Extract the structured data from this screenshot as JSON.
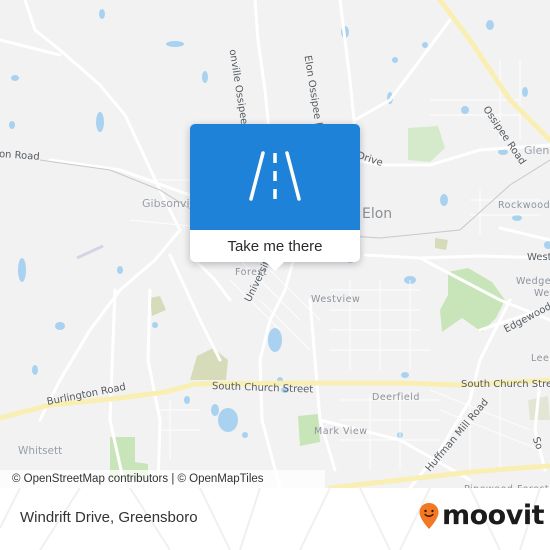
{
  "map": {
    "road_labels": {
      "clapp_mill": "Ossipee Road",
      "elon_ossipee": "Elon Ossipee Road",
      "ossipee": "Ossipee Road",
      "burlington_left": "on Road",
      "drive": "Drive",
      "university": "University Drive",
      "burlington": "Burlington Road",
      "church_mid": "South Church Street",
      "church_right": "South Church Stre",
      "huffman": "Huffman Mill Road",
      "edgewood": "Edgewood",
      "west": "West",
      "south_edge": "So"
    },
    "place_labels": {
      "gibsonville": "Gibsonvi",
      "elon": "Elon",
      "glen": "Glen",
      "rockwood": "Rockwood",
      "westbrook_forest": "Forest",
      "westview": "Westview",
      "wedge": "Wedge",
      "we": "We",
      "lee": "Lee",
      "deerfield": "Deerfield",
      "mark_view": "Mark View",
      "whitsett": "Whitsett",
      "pinewood": "Pinewood Forest"
    },
    "road_label_prefix": "onville"
  },
  "popup": {
    "icon": "road-icon",
    "button_label": "Take me there"
  },
  "attribution": "© OpenStreetMap contributors | © OpenMapTiles",
  "footer": {
    "place_name": "Windrift Drive, Greensboro",
    "brand": "moovit",
    "brand_color": "#f47721"
  },
  "colors": {
    "popup_blue": "#1e82d8",
    "water": "#a8d2f0",
    "park": "#c7e5b9",
    "highway": "#f9efb2"
  }
}
